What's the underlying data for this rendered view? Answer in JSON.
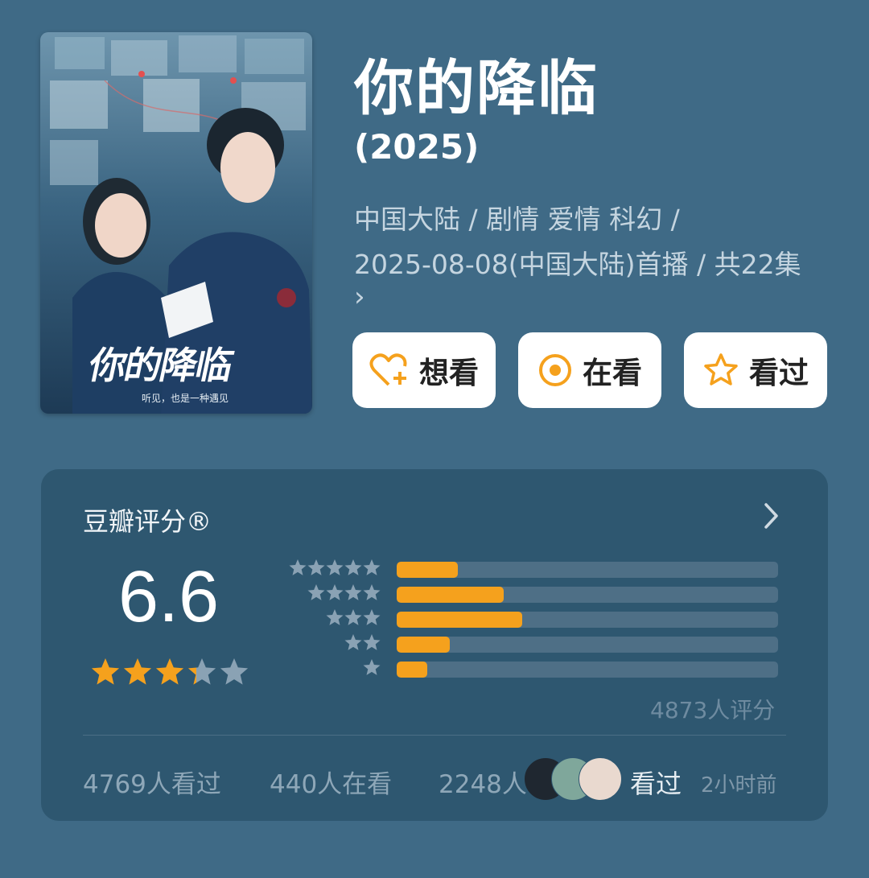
{
  "movie": {
    "title": "你的降临",
    "year": "(2025)",
    "meta_line1": "中国大陆 / 剧情 爱情 科幻 /",
    "meta_line2": "2025-08-08(中国大陆)首播 / 共22集",
    "meta_more": "›",
    "poster_title": "你的降临",
    "poster_tagline": "听见，也是一种遇见"
  },
  "actions": [
    {
      "label": "想看",
      "icon": "heart-plus-icon"
    },
    {
      "label": "在看",
      "icon": "target-icon"
    },
    {
      "label": "看过",
      "icon": "star-outline-icon"
    }
  ],
  "rating": {
    "card_title": "豆瓣评分®",
    "score": "6.6",
    "stars_value": 3.3,
    "stars_max": 5,
    "distribution_percent": [
      16,
      28,
      33,
      14,
      8
    ],
    "count_text": "4873人评分"
  },
  "stats": {
    "watched": "4769人看过",
    "watching": "440人在看",
    "want": "2248人",
    "friend_status": "看过",
    "friend_time": "2小时前"
  },
  "colors": {
    "background": "#3f6a86",
    "card": "#2e5770",
    "accent": "#f5a11d",
    "star_empty": "#8aa2b4"
  }
}
